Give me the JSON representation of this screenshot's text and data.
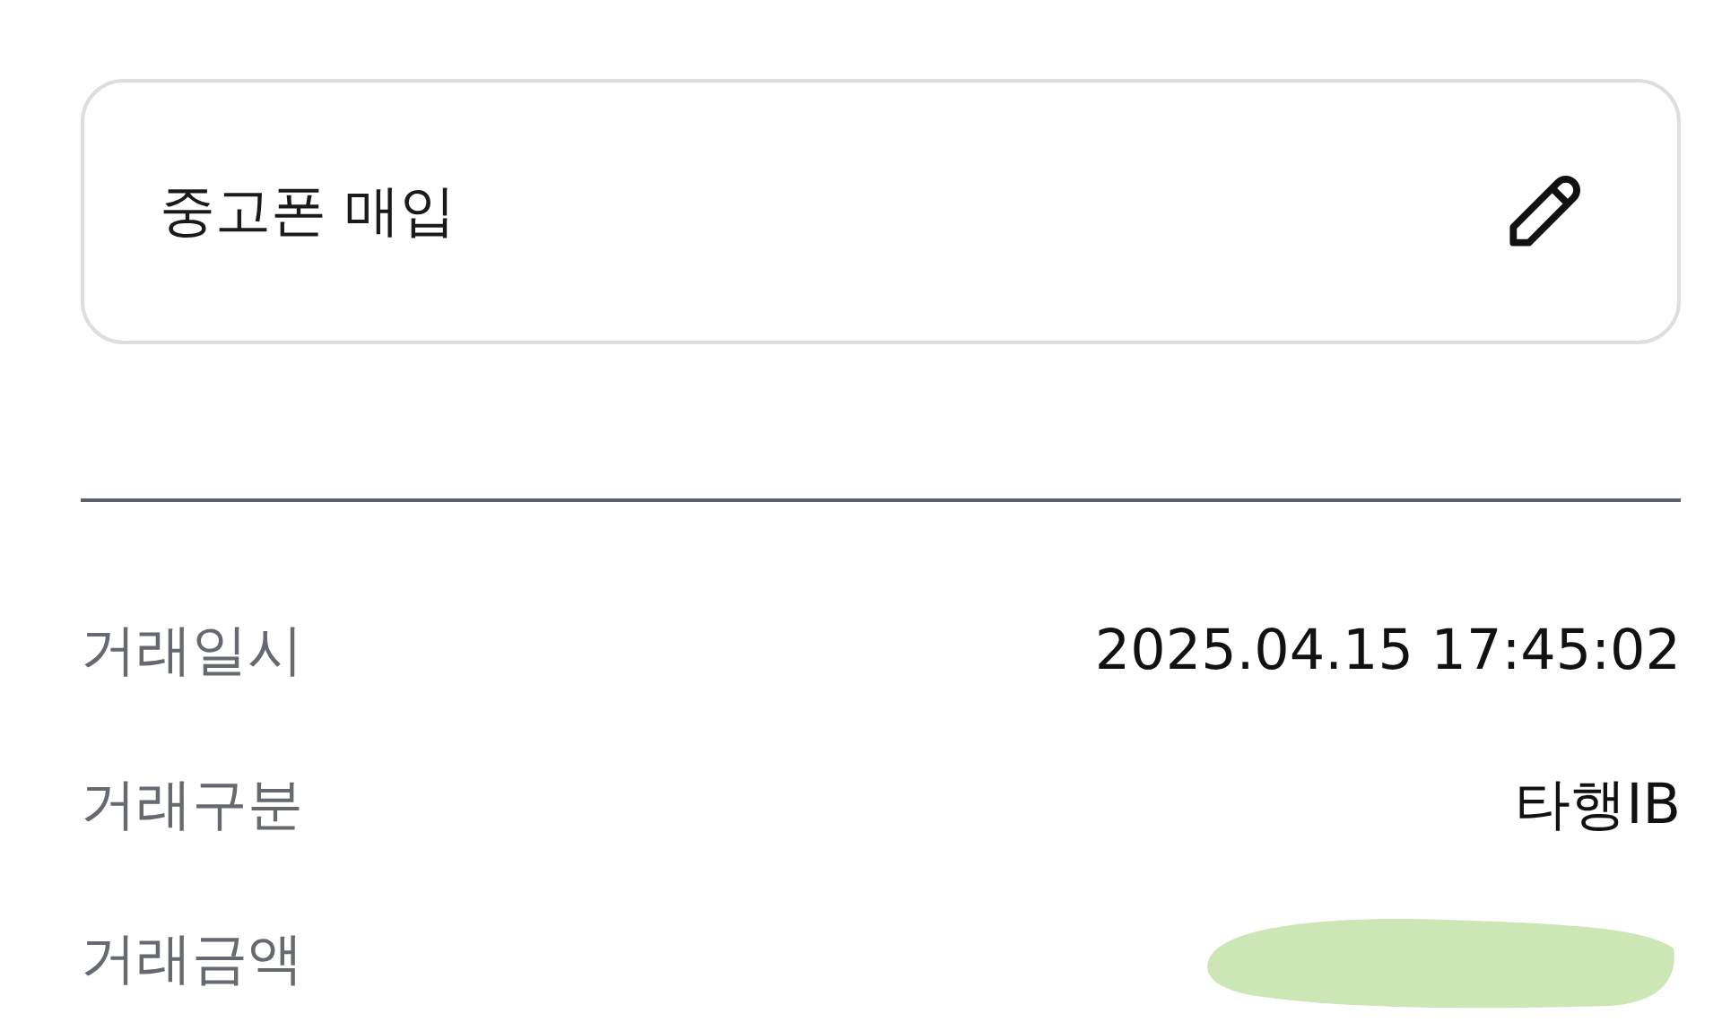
{
  "card": {
    "title": "중고폰 매입"
  },
  "details": [
    {
      "kind": "text",
      "label": "거래일시",
      "value": "2025.04.15 17:45:02"
    },
    {
      "kind": "text",
      "label": "거래구분",
      "value": "타행IB"
    },
    {
      "kind": "redacted",
      "label": "거래금액"
    }
  ]
}
